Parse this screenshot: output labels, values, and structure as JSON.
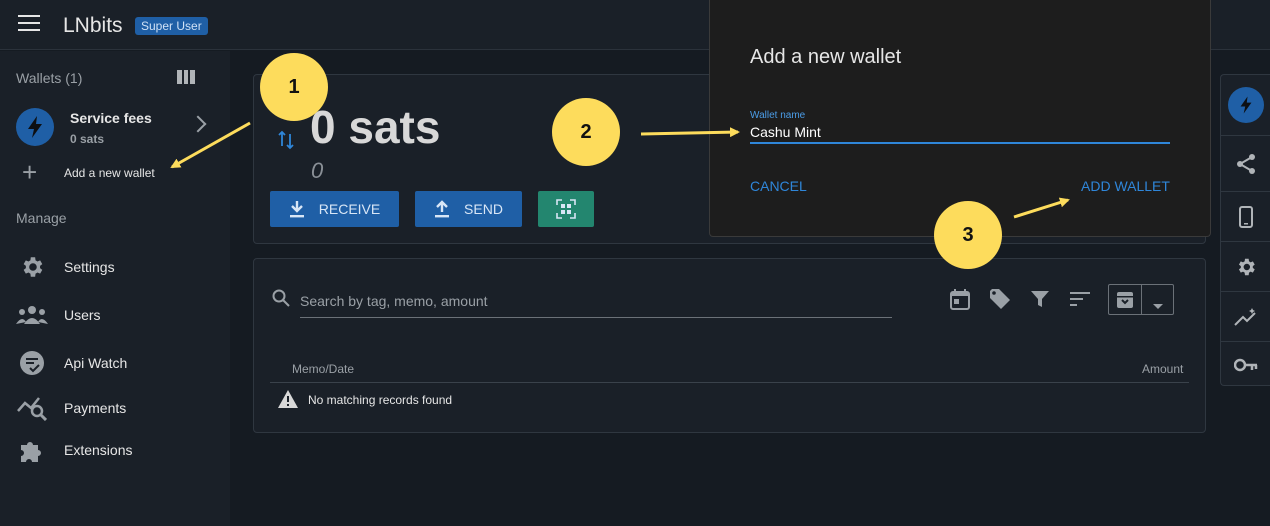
{
  "header": {
    "brand": "LNbits",
    "badge": "Super User"
  },
  "sidebar": {
    "wallets_title": "Wallets (1)",
    "wallet": {
      "name": "Service fees",
      "balance": "0 sats"
    },
    "add_wallet_label": "Add a new wallet",
    "manage_title": "Manage",
    "nav": [
      {
        "label": "Settings",
        "icon": "gear-icon"
      },
      {
        "label": "Users",
        "icon": "users-icon"
      },
      {
        "label": "Api Watch",
        "icon": "api-watch-icon"
      },
      {
        "label": "Payments",
        "icon": "payments-icon"
      },
      {
        "label": "Extensions",
        "icon": "puzzle-icon"
      }
    ]
  },
  "wallet_card": {
    "balance": "0 sats",
    "fiat": "0",
    "receive_label": "RECEIVE",
    "send_label": "SEND"
  },
  "transactions": {
    "search_placeholder": "Search by tag, memo, amount",
    "col_memo": "Memo/Date",
    "col_amount": "Amount",
    "empty_text": "No matching records found"
  },
  "dialog": {
    "title": "Add a new wallet",
    "field_label": "Wallet name",
    "field_value": "Cashu Mint",
    "cancel_label": "CANCEL",
    "confirm_label": "ADD WALLET"
  },
  "annotations": {
    "m1": "1",
    "m2": "2",
    "m3": "3"
  },
  "colors": {
    "primary": "#1f5fa6",
    "secondary": "#23866f",
    "accent_link": "#2f86d9",
    "marker": "#fddc5c"
  }
}
